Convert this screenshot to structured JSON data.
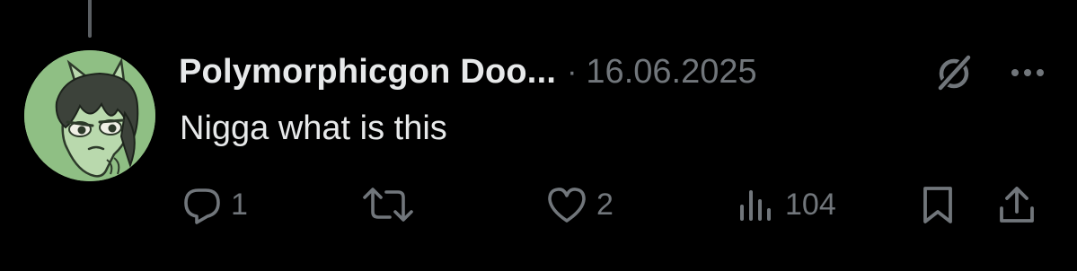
{
  "post": {
    "author": {
      "display_name": "Polymorphicgon Doo...",
      "avatar_bg": "#8fbf84"
    },
    "separator": "·",
    "timestamp": "16.06.2025",
    "text": "Nigga what is this"
  },
  "actions": {
    "reply": {
      "icon": "reply-icon",
      "count": "1"
    },
    "repost": {
      "icon": "repost-icon",
      "count": ""
    },
    "like": {
      "icon": "heart-icon",
      "count": "2"
    },
    "views": {
      "icon": "views-icon",
      "count": "104"
    },
    "bookmark": {
      "icon": "bookmark-icon"
    },
    "share": {
      "icon": "share-icon"
    }
  },
  "theme": {
    "background": "#000000",
    "text_primary": "#e7e9ea",
    "text_secondary": "#71767b",
    "thread_line": "#5b5f63"
  }
}
